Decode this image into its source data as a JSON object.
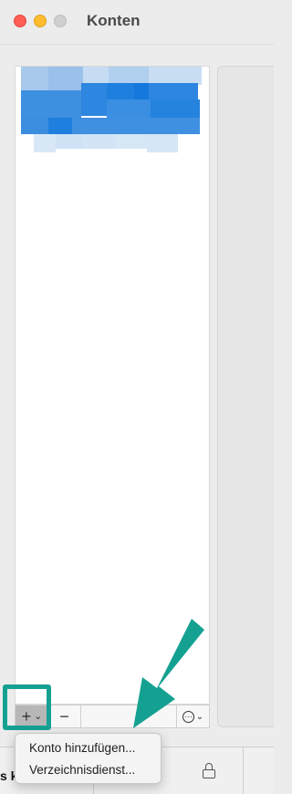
{
  "window": {
    "title": "Konten"
  },
  "colors": {
    "annotation": "#15a192",
    "close": "#ff5f57",
    "minimize": "#febc2e"
  },
  "accounts_list": {
    "toolbar": {
      "add_symbol": "+",
      "add_chevron": "⌄",
      "remove_symbol": "−",
      "more_symbol": "⋯",
      "more_chevron": "⌄"
    }
  },
  "add_menu": {
    "items": [
      "Konto hinzufügen...",
      "Verzeichnisdienst..."
    ]
  },
  "bottom_bar": {
    "partial_text": "s k"
  },
  "icons": [
    "close-icon",
    "minimize-icon",
    "zoom-icon",
    "plus-icon",
    "chevron-down-icon",
    "minus-icon",
    "ellipsis-circle-icon",
    "lock-icon",
    "arrow-icon"
  ]
}
